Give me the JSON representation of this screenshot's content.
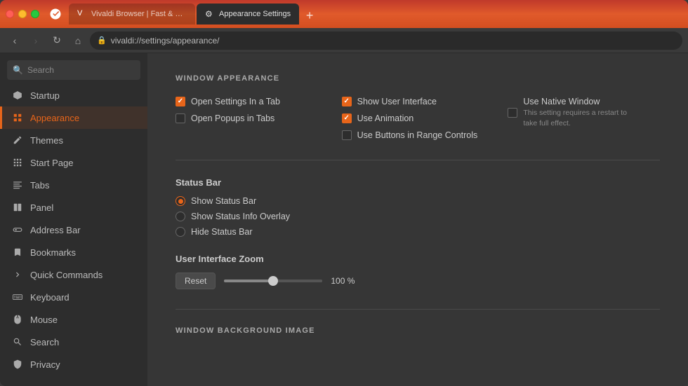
{
  "browser": {
    "tabs": [
      {
        "id": "tab-vivaldi",
        "label": "Vivaldi Browser | Fast & Flexi",
        "favicon": "V",
        "active": false
      },
      {
        "id": "tab-settings",
        "label": "Appearance Settings",
        "favicon": "⚙",
        "active": true
      }
    ],
    "new_tab_label": "+",
    "address_bar": {
      "url": "vivaldi://settings/appearance/",
      "security_icon": "🔒"
    }
  },
  "nav": {
    "back_btn": "‹",
    "forward_btn": "›",
    "reload_btn": "↻",
    "home_btn": "⌂"
  },
  "sidebar": {
    "search_placeholder": "Search",
    "items": [
      {
        "id": "startup",
        "label": "Startup",
        "icon": "V"
      },
      {
        "id": "appearance",
        "label": "Appearance",
        "icon": "☐",
        "active": true
      },
      {
        "id": "themes",
        "label": "Themes",
        "icon": "✎"
      },
      {
        "id": "start-page",
        "label": "Start Page",
        "icon": "⊞"
      },
      {
        "id": "tabs",
        "label": "Tabs",
        "icon": "≡"
      },
      {
        "id": "panel",
        "label": "Panel",
        "icon": "▭"
      },
      {
        "id": "address-bar",
        "label": "Address Bar",
        "icon": "⊡"
      },
      {
        "id": "bookmarks",
        "label": "Bookmarks",
        "icon": "☐"
      },
      {
        "id": "quick-commands",
        "label": "Quick Commands",
        "icon": "≻"
      },
      {
        "id": "keyboard",
        "label": "Keyboard",
        "icon": "⌨"
      },
      {
        "id": "mouse",
        "label": "Mouse",
        "icon": "🖱"
      },
      {
        "id": "search",
        "label": "Search",
        "icon": "🔍"
      },
      {
        "id": "privacy",
        "label": "Privacy",
        "icon": "🔒"
      }
    ]
  },
  "content": {
    "window_appearance": {
      "section_title": "WINDOW APPEARANCE",
      "checkboxes_col1": [
        {
          "id": "open-settings-tab",
          "label": "Open Settings In a Tab",
          "checked": true
        },
        {
          "id": "open-popups-tabs",
          "label": "Open Popups in Tabs",
          "checked": false
        }
      ],
      "checkboxes_col2": [
        {
          "id": "show-user-interface",
          "label": "Show User Interface",
          "checked": true
        },
        {
          "id": "use-animation",
          "label": "Use Animation",
          "checked": true
        },
        {
          "id": "use-buttons-range",
          "label": "Use Buttons in Range Controls",
          "checked": false
        }
      ],
      "checkboxes_col3": [
        {
          "id": "use-native-window",
          "label": "Use Native Window",
          "checked": false
        }
      ],
      "native_window_note": "This setting requires a restart to take full effect."
    },
    "status_bar": {
      "subsection_title": "Status Bar",
      "options": [
        {
          "id": "show-status-bar",
          "label": "Show Status Bar",
          "selected": true
        },
        {
          "id": "show-status-info",
          "label": "Show Status Info Overlay",
          "selected": false
        },
        {
          "id": "hide-status-bar",
          "label": "Hide Status Bar",
          "selected": false
        }
      ]
    },
    "zoom": {
      "subsection_title": "User Interface Zoom",
      "reset_label": "Reset",
      "value": "100 %",
      "slider_percent": 50
    },
    "window_background": {
      "section_title": "WINDOW BACKGROUND IMAGE"
    }
  }
}
